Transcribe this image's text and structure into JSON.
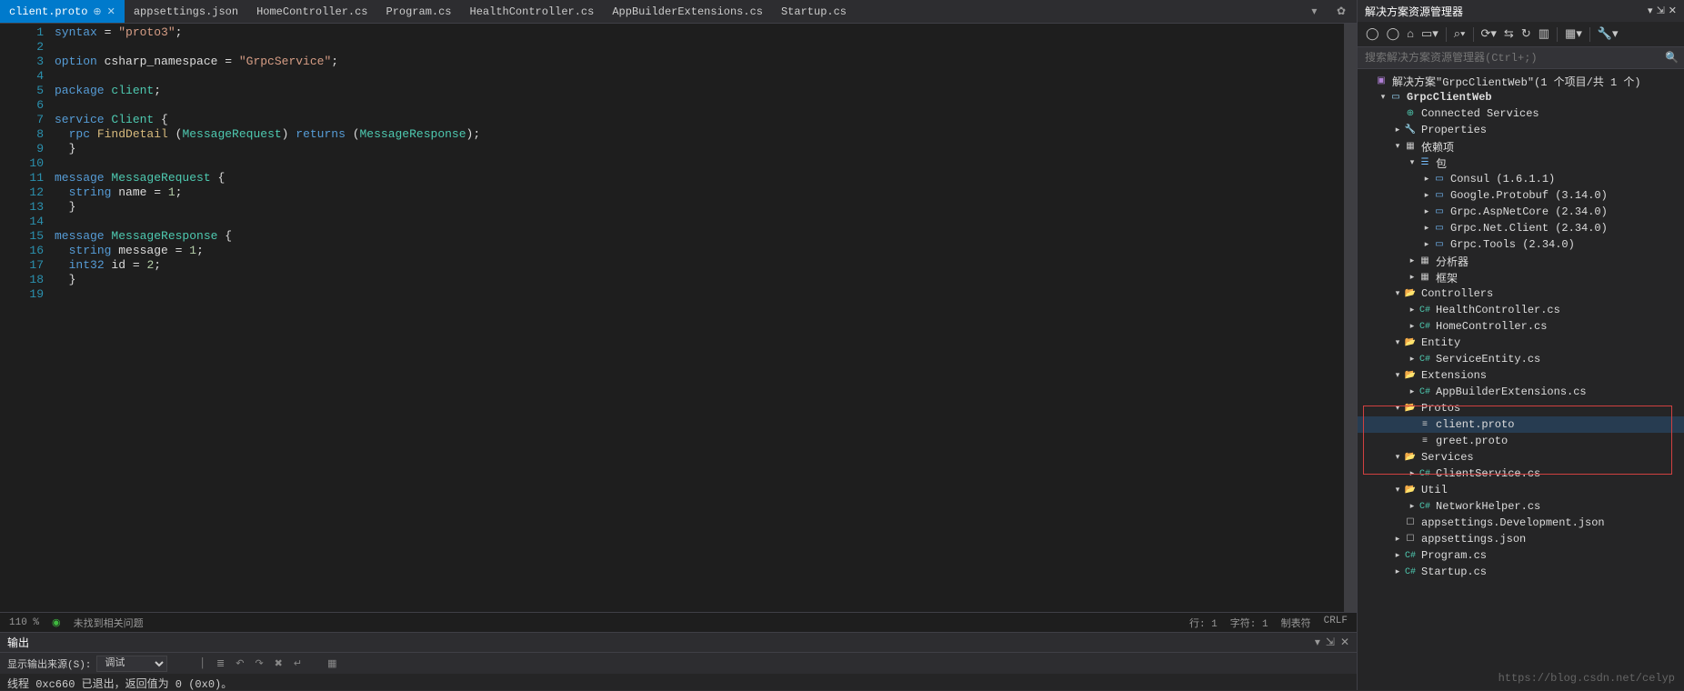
{
  "tabs": [
    {
      "label": "client.proto",
      "active": true,
      "pinned": true
    },
    {
      "label": "appsettings.json"
    },
    {
      "label": "HomeController.cs"
    },
    {
      "label": "Program.cs"
    },
    {
      "label": "HealthController.cs"
    },
    {
      "label": "AppBuilderExtensions.cs"
    },
    {
      "label": "Startup.cs"
    }
  ],
  "code_lines": [
    [
      {
        "c": "k-blue",
        "t": "syntax"
      },
      {
        "c": "k-white",
        "t": " = "
      },
      {
        "c": "k-str",
        "t": "\"proto3\""
      },
      {
        "c": "k-white",
        "t": ";"
      }
    ],
    [],
    [
      {
        "c": "k-blue",
        "t": "option"
      },
      {
        "c": "k-white",
        "t": " csharp_namespace = "
      },
      {
        "c": "k-str",
        "t": "\"GrpcService\""
      },
      {
        "c": "k-white",
        "t": ";"
      }
    ],
    [],
    [
      {
        "c": "k-blue",
        "t": "package"
      },
      {
        "c": "k-white",
        "t": " "
      },
      {
        "c": "k-teal",
        "t": "client"
      },
      {
        "c": "k-white",
        "t": ";"
      }
    ],
    [],
    [
      {
        "c": "k-blue",
        "t": "service"
      },
      {
        "c": "k-white",
        "t": " "
      },
      {
        "c": "k-teal",
        "t": "Client"
      },
      {
        "c": "k-white",
        "t": " {"
      }
    ],
    [
      {
        "c": "k-white",
        "t": "  "
      },
      {
        "c": "k-blue",
        "t": "rpc"
      },
      {
        "c": "k-white",
        "t": " "
      },
      {
        "c": "k-orange",
        "t": "FindDetail"
      },
      {
        "c": "k-white",
        "t": " ("
      },
      {
        "c": "k-teal",
        "t": "MessageRequest"
      },
      {
        "c": "k-white",
        "t": ") "
      },
      {
        "c": "k-blue",
        "t": "returns"
      },
      {
        "c": "k-white",
        "t": " ("
      },
      {
        "c": "k-teal",
        "t": "MessageResponse"
      },
      {
        "c": "k-white",
        "t": ");"
      }
    ],
    [
      {
        "c": "k-white",
        "t": "  }"
      }
    ],
    [],
    [
      {
        "c": "k-blue",
        "t": "message"
      },
      {
        "c": "k-white",
        "t": " "
      },
      {
        "c": "k-teal",
        "t": "MessageRequest"
      },
      {
        "c": "k-white",
        "t": " {"
      }
    ],
    [
      {
        "c": "k-white",
        "t": "  "
      },
      {
        "c": "k-blue",
        "t": "string"
      },
      {
        "c": "k-white",
        "t": " name = "
      },
      {
        "c": "k-num",
        "t": "1"
      },
      {
        "c": "k-white",
        "t": ";"
      }
    ],
    [
      {
        "c": "k-white",
        "t": "  }"
      }
    ],
    [],
    [
      {
        "c": "k-blue",
        "t": "message"
      },
      {
        "c": "k-white",
        "t": " "
      },
      {
        "c": "k-teal",
        "t": "MessageResponse"
      },
      {
        "c": "k-white",
        "t": " {"
      }
    ],
    [
      {
        "c": "k-white",
        "t": "  "
      },
      {
        "c": "k-blue",
        "t": "string"
      },
      {
        "c": "k-white",
        "t": " message = "
      },
      {
        "c": "k-num",
        "t": "1"
      },
      {
        "c": "k-white",
        "t": ";"
      }
    ],
    [
      {
        "c": "k-white",
        "t": "  "
      },
      {
        "c": "k-blue",
        "t": "int32"
      },
      {
        "c": "k-white",
        "t": " id = "
      },
      {
        "c": "k-num",
        "t": "2"
      },
      {
        "c": "k-white",
        "t": ";"
      }
    ],
    [
      {
        "c": "k-white",
        "t": "  }"
      }
    ],
    []
  ],
  "status": {
    "zoom": "110 %",
    "issues": "未找到相关问题",
    "line": "行: 1",
    "col": "字符: 1",
    "tab": "制表符",
    "eol": "CRLF"
  },
  "output": {
    "title": "输出",
    "source_label": "显示输出来源(S):",
    "source_value": "调试",
    "body": "线程 0xc660 已退出，返回值为 0 (0x0)。"
  },
  "solution_explorer": {
    "title": "解决方案资源管理器",
    "search_placeholder": "搜索解决方案资源管理器(Ctrl+;)",
    "tree": [
      {
        "d": 0,
        "a": "empty",
        "ico": "ico-sln",
        "g": "▣",
        "lbl": "解决方案\"GrpcClientWeb\"(1 个项目/共 1 个)"
      },
      {
        "d": 1,
        "a": "down",
        "ico": "ico-proj",
        "g": "▭",
        "lbl": "GrpcClientWeb",
        "bold": true
      },
      {
        "d": 2,
        "a": "empty",
        "ico": "ico-conn",
        "g": "⊕",
        "lbl": "Connected Services"
      },
      {
        "d": 2,
        "a": "right",
        "ico": "ico-wrench",
        "g": "🔧",
        "lbl": "Properties"
      },
      {
        "d": 2,
        "a": "down",
        "ico": "ico-ref",
        "g": "▦",
        "lbl": "依赖项"
      },
      {
        "d": 3,
        "a": "down",
        "ico": "ico-pkg",
        "g": "☰",
        "lbl": "包"
      },
      {
        "d": 4,
        "a": "right",
        "ico": "ico-pkg",
        "g": "▭",
        "lbl": "Consul (1.6.1.1)"
      },
      {
        "d": 4,
        "a": "right",
        "ico": "ico-pkg",
        "g": "▭",
        "lbl": "Google.Protobuf (3.14.0)"
      },
      {
        "d": 4,
        "a": "right",
        "ico": "ico-pkg",
        "g": "▭",
        "lbl": "Grpc.AspNetCore (2.34.0)"
      },
      {
        "d": 4,
        "a": "right",
        "ico": "ico-pkg",
        "g": "▭",
        "lbl": "Grpc.Net.Client (2.34.0)"
      },
      {
        "d": 4,
        "a": "right",
        "ico": "ico-pkg",
        "g": "▭",
        "lbl": "Grpc.Tools (2.34.0)"
      },
      {
        "d": 3,
        "a": "right",
        "ico": "ico-ref",
        "g": "▦",
        "lbl": "分析器"
      },
      {
        "d": 3,
        "a": "right",
        "ico": "ico-ref",
        "g": "▦",
        "lbl": "框架"
      },
      {
        "d": 2,
        "a": "down",
        "ico": "ico-foldo",
        "g": "📂",
        "lbl": "Controllers"
      },
      {
        "d": 3,
        "a": "right",
        "ico": "ico-cs",
        "g": "C#",
        "lbl": "HealthController.cs"
      },
      {
        "d": 3,
        "a": "right",
        "ico": "ico-cs",
        "g": "C#",
        "lbl": "HomeController.cs"
      },
      {
        "d": 2,
        "a": "down",
        "ico": "ico-foldo",
        "g": "📂",
        "lbl": "Entity"
      },
      {
        "d": 3,
        "a": "right",
        "ico": "ico-cs",
        "g": "C#",
        "lbl": "ServiceEntity.cs"
      },
      {
        "d": 2,
        "a": "down",
        "ico": "ico-foldo",
        "g": "📂",
        "lbl": "Extensions"
      },
      {
        "d": 3,
        "a": "right",
        "ico": "ico-cs",
        "g": "C#",
        "lbl": "AppBuilderExtensions.cs"
      },
      {
        "d": 2,
        "a": "down",
        "ico": "ico-foldo",
        "g": "📂",
        "lbl": "Protos"
      },
      {
        "d": 3,
        "a": "empty",
        "ico": "ico-proto",
        "g": "≡",
        "lbl": "client.proto",
        "selected": true
      },
      {
        "d": 3,
        "a": "empty",
        "ico": "ico-proto",
        "g": "≡",
        "lbl": "greet.proto"
      },
      {
        "d": 2,
        "a": "down",
        "ico": "ico-foldo",
        "g": "📂",
        "lbl": "Services"
      },
      {
        "d": 3,
        "a": "right",
        "ico": "ico-cs",
        "g": "C#",
        "lbl": "ClientService.cs"
      },
      {
        "d": 2,
        "a": "down",
        "ico": "ico-foldo",
        "g": "📂",
        "lbl": "Util"
      },
      {
        "d": 3,
        "a": "right",
        "ico": "ico-cs",
        "g": "C#",
        "lbl": "NetworkHelper.cs"
      },
      {
        "d": 2,
        "a": "empty",
        "ico": "ico-json",
        "g": "☐",
        "lbl": "appsettings.Development.json"
      },
      {
        "d": 2,
        "a": "right",
        "ico": "ico-json",
        "g": "☐",
        "lbl": "appsettings.json"
      },
      {
        "d": 2,
        "a": "right",
        "ico": "ico-cs",
        "g": "C#",
        "lbl": "Program.cs"
      },
      {
        "d": 2,
        "a": "right",
        "ico": "ico-cs",
        "g": "C#",
        "lbl": "Startup.cs"
      }
    ]
  },
  "watermark": "https://blog.csdn.net/celyp"
}
